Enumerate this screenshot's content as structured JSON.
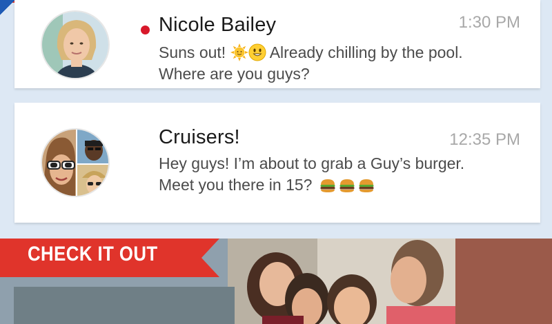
{
  "conversations": [
    {
      "name": "Nicole Bailey",
      "time": "1:30 PM",
      "unread": true,
      "message_parts": [
        "Suns out! ",
        " Already chilling by the pool. Where are you guys?"
      ],
      "emojis": [
        "sun-emoji",
        "smiley-emoji"
      ]
    },
    {
      "name": "Cruisers!",
      "time": "12:35 PM",
      "unread": false,
      "message": "Hey guys!  I’m about to grab a Guy’s burger. Meet you there in 15?",
      "emojis": [
        "burger-emoji",
        "burger-emoji",
        "burger-emoji"
      ]
    }
  ],
  "banner": {
    "label": "CHECK IT OUT"
  },
  "colors": {
    "unread_dot": "#d8182a",
    "ribbon_red": "#e0342b",
    "ribbon_blue": "#1f5bb5",
    "background": "#dde8f4"
  }
}
